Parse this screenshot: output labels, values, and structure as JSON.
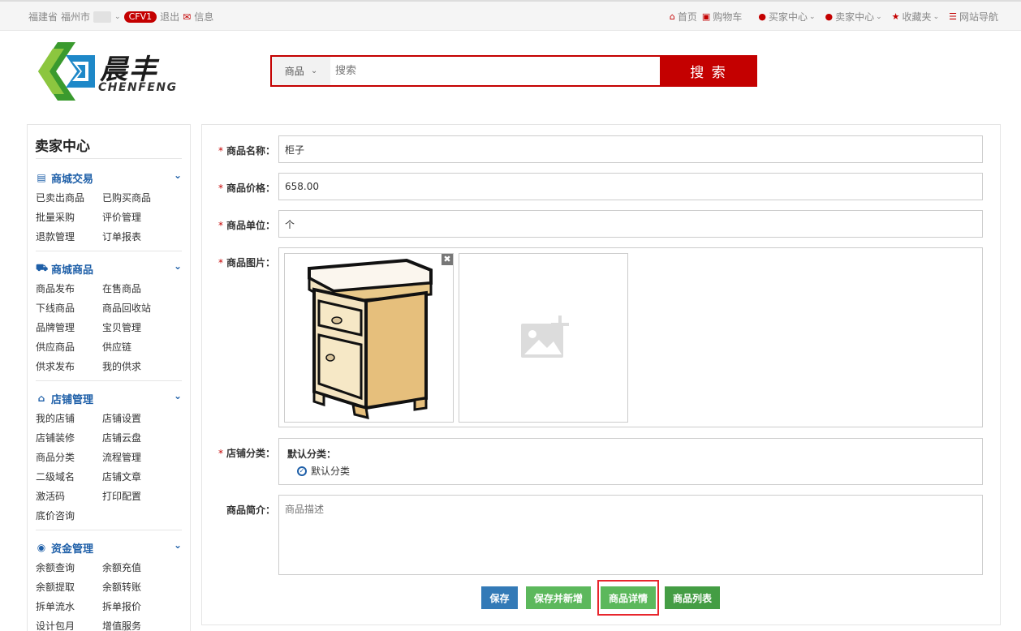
{
  "topbar": {
    "province": "福建省",
    "city": "福州市",
    "badge": "CFV1",
    "logout": "退出",
    "message": "信息",
    "links": [
      {
        "label": "首页",
        "icon": "home-icon"
      },
      {
        "label": "购物车",
        "icon": "cart-icon"
      },
      {
        "label": "买家中心",
        "icon": "user-icon"
      },
      {
        "label": "卖家中心",
        "icon": "user-icon"
      },
      {
        "label": "收藏夹",
        "icon": "star-icon"
      },
      {
        "label": "网站导航",
        "icon": "list-icon"
      }
    ]
  },
  "logo": {
    "cn": "晨丰",
    "en": "CHENFENG"
  },
  "search": {
    "category": "商品",
    "placeholder": "搜索",
    "button": "搜 索"
  },
  "sidebar": {
    "title": "卖家中心",
    "groups": [
      {
        "title": "商城交易",
        "icon": "list-icon",
        "links": [
          "已卖出商品",
          "已购买商品",
          "批量采购",
          "评价管理",
          "退款管理",
          "订单报表"
        ]
      },
      {
        "title": "商城商品",
        "icon": "truck-icon",
        "links": [
          "商品发布",
          "在售商品",
          "下线商品",
          "商品回收站",
          "品牌管理",
          "宝贝管理",
          "供应商品",
          "供应链",
          "供求发布",
          "我的供求"
        ]
      },
      {
        "title": "店铺管理",
        "icon": "home-icon",
        "links": [
          "我的店铺",
          "店铺设置",
          "店铺装修",
          "店铺云盘",
          "商品分类",
          "流程管理",
          "二级域名",
          "店铺文章",
          "激活码",
          "打印配置",
          "底价咨询"
        ]
      },
      {
        "title": "资金管理",
        "icon": "money-icon",
        "links": [
          "余额查询",
          "余额充值",
          "余额提取",
          "余额转账",
          "拆单流水",
          "拆单报价",
          "设计包月",
          "增值服务"
        ]
      }
    ]
  },
  "form": {
    "name_label": "商品名称：",
    "name_value": "柜子",
    "price_label": "商品价格：",
    "price_value": "658.00",
    "unit_label": "商品单位：",
    "unit_value": "个",
    "image_label": "商品图片：",
    "category_label": "店铺分类：",
    "category_head": "默认分类：",
    "category_option": "默认分类",
    "desc_label": "商品简介：",
    "desc_placeholder": "商品描述"
  },
  "buttons": {
    "save": "保存",
    "save_new": "保存并新增",
    "detail": "商品详情",
    "list": "商品列表"
  },
  "colors": {
    "brand_red": "#c40000",
    "link_blue": "#1e5fa8",
    "btn_blue": "#337ab7",
    "btn_green": "#5cb85c"
  }
}
